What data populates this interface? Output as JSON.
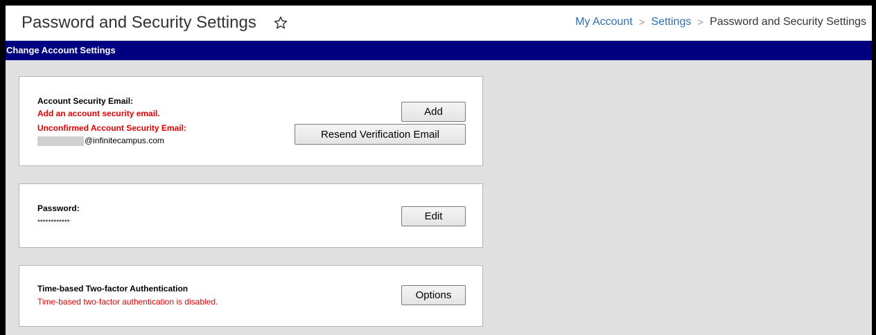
{
  "header": {
    "title": "Password and Security Settings",
    "breadcrumb": {
      "items": [
        {
          "label": "My Account"
        },
        {
          "label": "Settings"
        },
        {
          "label": "Password and Security Settings"
        }
      ],
      "separator": ">"
    }
  },
  "section": {
    "title": "Change Account Settings"
  },
  "security_email": {
    "label": "Account Security Email:",
    "add_prompt": "Add an account security email.",
    "unconfirmed_label": "Unconfirmed Account Security Email:",
    "email_domain": "@infinitecampus.com",
    "add_button": "Add",
    "resend_button": "Resend Verification Email"
  },
  "password": {
    "label": "Password:",
    "masked_value": "************",
    "edit_button": "Edit"
  },
  "two_factor": {
    "label": "Time-based Two-factor Authentication",
    "status": "Time-based two-factor authentication is disabled.",
    "options_button": "Options"
  },
  "colors": {
    "section_bar": "#000080",
    "link": "#2c6fb7",
    "error_text": "#e00000",
    "page_background": "#e0e0e0"
  },
  "icons": {
    "favorite": "star-outline-icon",
    "breadcrumb_separator": "chevron-right-icon"
  }
}
